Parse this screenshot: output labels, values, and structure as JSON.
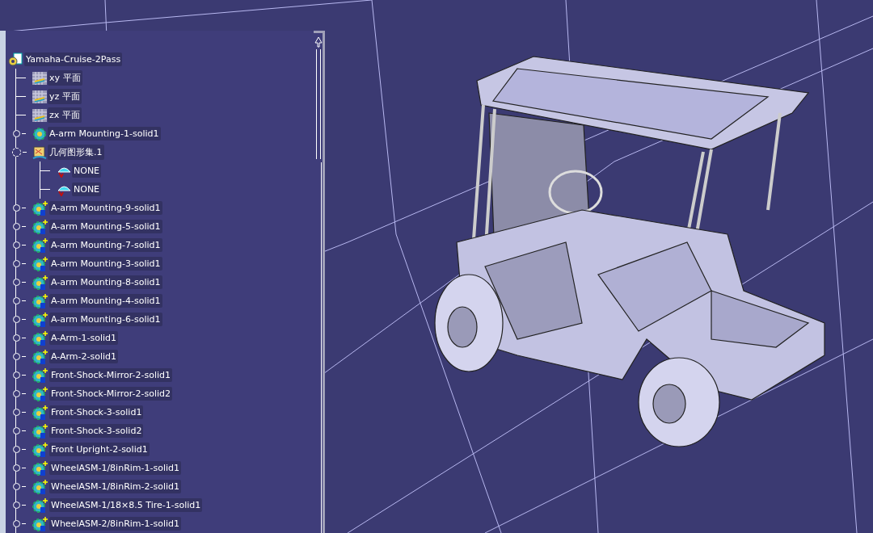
{
  "tree": {
    "label": "Yamaha-Cruise-2Pass",
    "kind": "product",
    "children": [
      {
        "label": "xy 平面",
        "kind": "plane"
      },
      {
        "label": "yz 平面",
        "kind": "plane"
      },
      {
        "label": "zx 平面",
        "kind": "plane"
      },
      {
        "label": "A-arm Mounting-1-solid1",
        "kind": "part",
        "expanded": false
      },
      {
        "label": "几何图形集.1",
        "kind": "geoset",
        "expanded": true,
        "children": [
          {
            "label": "NONE",
            "kind": "surface"
          },
          {
            "label": "NONE",
            "kind": "surface"
          }
        ]
      },
      {
        "label": "A-arm Mounting-9-solid1",
        "kind": "part-new",
        "expanded": false
      },
      {
        "label": "A-arm Mounting-5-solid1",
        "kind": "part-new",
        "expanded": false
      },
      {
        "label": "A-arm Mounting-7-solid1",
        "kind": "part-new",
        "expanded": false
      },
      {
        "label": "A-arm Mounting-3-solid1",
        "kind": "part-new",
        "expanded": false
      },
      {
        "label": "A-arm Mounting-8-solid1",
        "kind": "part-new",
        "expanded": false
      },
      {
        "label": "A-arm Mounting-4-solid1",
        "kind": "part-new",
        "expanded": false
      },
      {
        "label": "A-arm Mounting-6-solid1",
        "kind": "part-new",
        "expanded": false
      },
      {
        "label": "A-Arm-1-solid1",
        "kind": "part-new",
        "expanded": false
      },
      {
        "label": "A-Arm-2-solid1",
        "kind": "part-new",
        "expanded": false
      },
      {
        "label": "Front-Shock-Mirror-2-solid1",
        "kind": "part-new",
        "expanded": false
      },
      {
        "label": "Front-Shock-Mirror-2-solid2",
        "kind": "part-new",
        "expanded": false
      },
      {
        "label": "Front-Shock-3-solid1",
        "kind": "part-new",
        "expanded": false
      },
      {
        "label": "Front-Shock-3-solid2",
        "kind": "part-new",
        "expanded": false
      },
      {
        "label": "Front Upright-2-solid1",
        "kind": "part-new",
        "expanded": false
      },
      {
        "label": "WheelASM-1/8inRim-1-solid1",
        "kind": "part-new",
        "expanded": false
      },
      {
        "label": "WheelASM-1/8inRim-2-solid1",
        "kind": "part-new",
        "expanded": false
      },
      {
        "label": "WheelASM-1/18×8.5 Tire-1-solid1",
        "kind": "part-new",
        "expanded": false
      },
      {
        "label": "WheelASM-2/8inRim-1-solid1",
        "kind": "part-new",
        "expanded": false
      }
    ]
  }
}
